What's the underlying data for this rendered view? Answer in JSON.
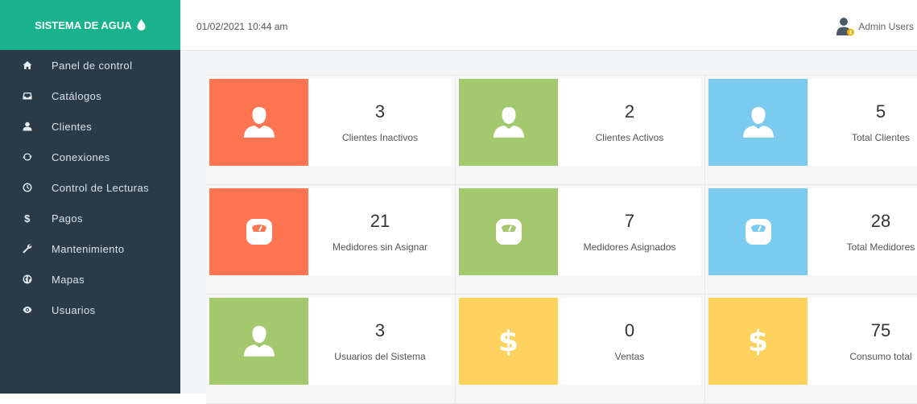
{
  "brand": {
    "title": "SISTEMA DE AGUA"
  },
  "header": {
    "datetime": "01/02/2021 10:44 am",
    "user": "Admin Users"
  },
  "sidebar": {
    "items": [
      {
        "label": "Panel de control",
        "icon": "home-icon"
      },
      {
        "label": "Catálogos",
        "icon": "inbox-icon"
      },
      {
        "label": "Clientes",
        "icon": "user-icon"
      },
      {
        "label": "Conexiones",
        "icon": "refresh-icon"
      },
      {
        "label": "Control de Lecturas",
        "icon": "clock-icon"
      },
      {
        "label": "Pagos",
        "icon": "dollar-icon"
      },
      {
        "label": "Mantenimiento",
        "icon": "wrench-icon"
      },
      {
        "label": "Mapas",
        "icon": "globe-icon"
      },
      {
        "label": "Usuarios",
        "icon": "eye-icon"
      }
    ]
  },
  "cards": [
    {
      "value": "3",
      "label": "Clientes Inactivos",
      "color": "#ff7552",
      "icon": "user-icon"
    },
    {
      "value": "2",
      "label": "Clientes Activos",
      "color": "#a3c86d",
      "icon": "user-icon"
    },
    {
      "value": "5",
      "label": "Total Clientes",
      "color": "#7acbee",
      "icon": "user-icon"
    },
    {
      "value": "21",
      "label": "Medidores sin Asignar",
      "color": "#ff7552",
      "icon": "meter-icon"
    },
    {
      "value": "7",
      "label": "Medidores Asignados",
      "color": "#a3c86d",
      "icon": "meter-icon"
    },
    {
      "value": "28",
      "label": "Total Medidores",
      "color": "#7acbee",
      "icon": "meter-icon"
    },
    {
      "value": "3",
      "label": "Usuarios del Sistema",
      "color": "#a3c86d",
      "icon": "user-icon"
    },
    {
      "value": "0",
      "label": "Ventas",
      "color": "#fdd25e",
      "icon": "dollar-icon",
      "glyph": "$"
    },
    {
      "value": "75",
      "label": "Consumo total",
      "color": "#fdd25e",
      "icon": "dollar-icon",
      "glyph": "$"
    }
  ],
  "colors": {
    "sidebar": "#2a3a47",
    "brand": "#18b38c",
    "orange": "#ff7552",
    "green": "#a3c86d",
    "blue": "#7acbee",
    "yellow": "#fdd25e"
  }
}
